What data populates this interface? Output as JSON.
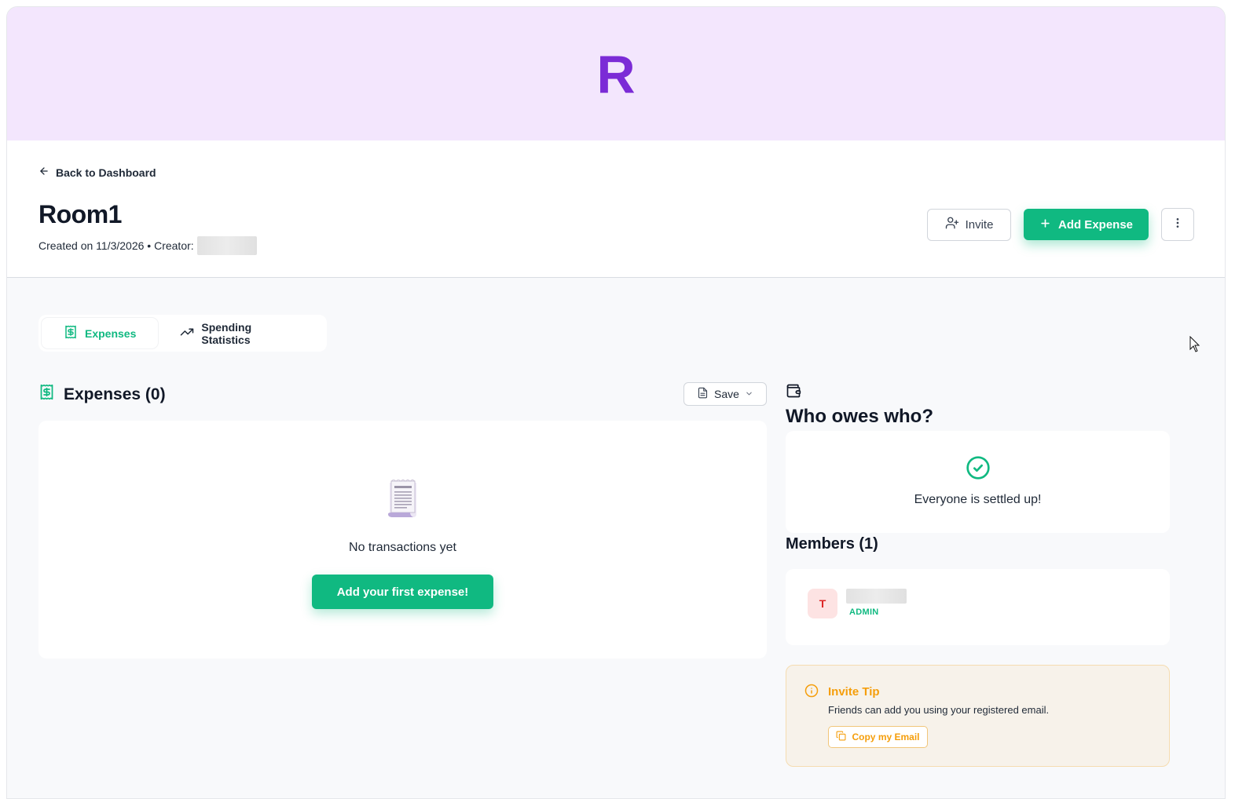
{
  "banner": {
    "letter": "R",
    "background": "#f3e6fd",
    "letter_color": "#7b2bd6"
  },
  "header": {
    "back_label": "Back to Dashboard",
    "room_name": "Room1",
    "created_text": "Created on 11/3/2026 • Creator:",
    "invite_label": "Invite",
    "add_expense_label": "Add Expense"
  },
  "tabs": [
    {
      "label": "Expenses",
      "icon": "receipt-dollar-icon",
      "active": true
    },
    {
      "label": "Spending Statistics",
      "icon": "trending-up-icon",
      "active": false
    }
  ],
  "expenses": {
    "title": "Expenses (0)",
    "save_label": "Save",
    "empty_text": "No transactions yet",
    "empty_icon": "receipt-icon",
    "first_expense_label": "Add your first expense!"
  },
  "balances": {
    "icon": "wallet-icon",
    "title": "Who owes who?",
    "settled_text": "Everyone is settled up!"
  },
  "members": {
    "title": "Members (1)",
    "list": [
      {
        "initial": "T",
        "role": "ADMIN"
      }
    ]
  },
  "invite_tip": {
    "title": "Invite Tip",
    "text": "Friends can add you using your registered email.",
    "copy_label": "Copy my Email"
  },
  "colors": {
    "accent": "#10b981",
    "warning": "#f59e0b",
    "danger": "#dc2626"
  }
}
